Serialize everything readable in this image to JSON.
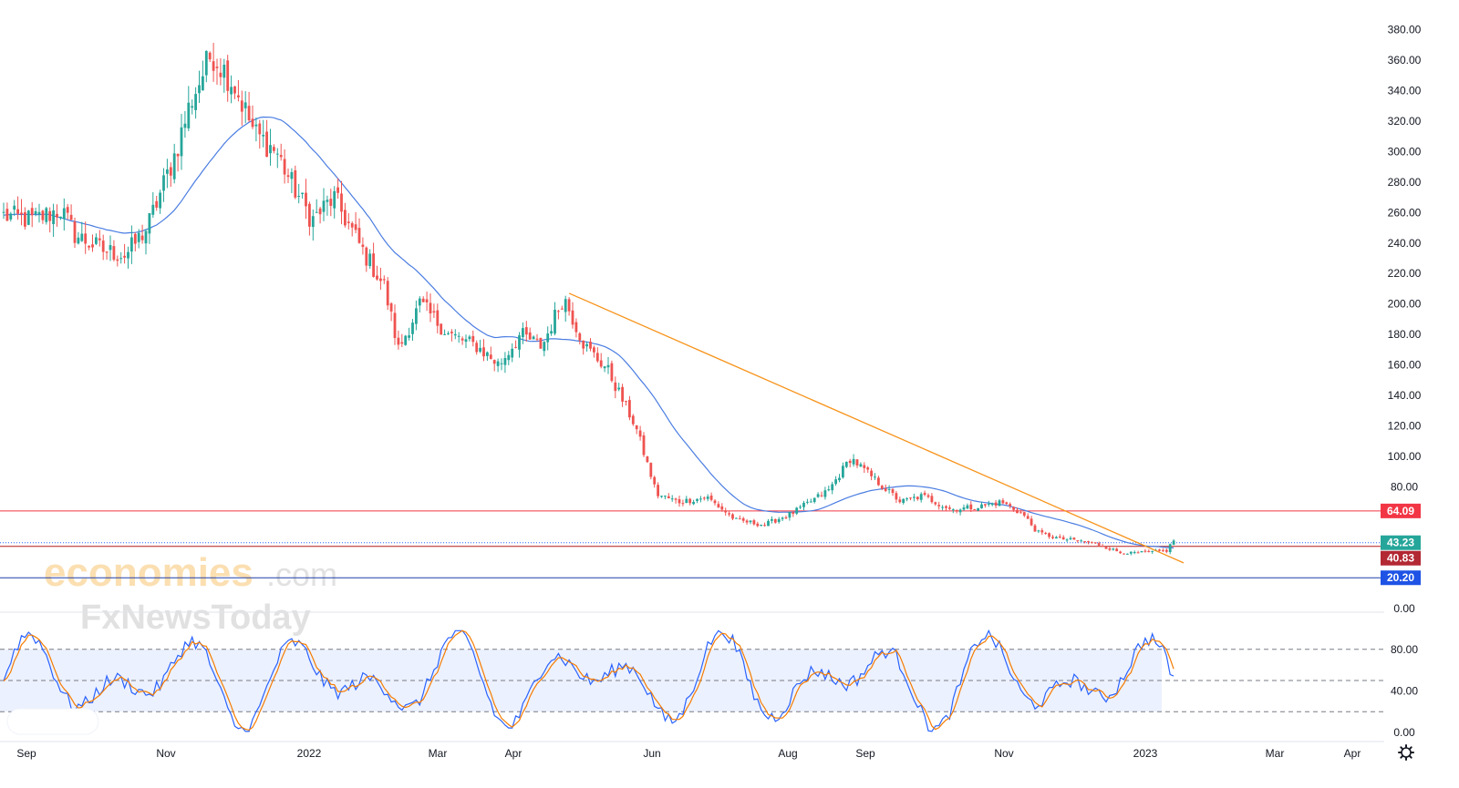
{
  "watermark": {
    "brand_main": "economies",
    "brand_suffix": ".com",
    "brand_sub": "FxNewsToday"
  },
  "chart_data": [
    {
      "type": "candlestick",
      "y_axis_ticks": [
        "380.00",
        "360.00",
        "340.00",
        "320.00",
        "300.00",
        "280.00",
        "260.00",
        "240.00",
        "220.00",
        "200.00",
        "180.00",
        "160.00",
        "140.00",
        "120.00",
        "100.00",
        "80.00",
        "0.00"
      ],
      "ylim": [
        0,
        390
      ],
      "x_axis_labels": [
        "Sep",
        "Nov",
        "2022",
        "Mar",
        "Apr",
        "Jun",
        "Aug",
        "Sep",
        "Nov",
        "2023",
        "Mar",
        "Apr"
      ],
      "grid": false,
      "price_levels": [
        {
          "label": "64.09",
          "value": 64.09,
          "color": "#f23645",
          "badge_color": "#f23645"
        },
        {
          "label": "43.23",
          "value": 43.23,
          "color": "#2962ff",
          "badge_color": "#26a69a",
          "dotted": true
        },
        {
          "label": "40.83",
          "value": 40.83,
          "color": "#b71c1c",
          "badge_color": "#b22833"
        },
        {
          "label": "20.20",
          "value": 20.2,
          "color": "#1e3fa8",
          "badge_color": "#1e53e5"
        }
      ],
      "trendline": {
        "from_value": 207,
        "to_value": 30,
        "color": "#f7931a"
      },
      "moving_average_color": "#4a7de2",
      "up_color": "#26a69a",
      "down_color": "#ef5350",
      "close_anchors": [
        [
          0,
          258
        ],
        [
          0.02,
          255
        ],
        [
          0.04,
          262
        ],
        [
          0.05,
          245
        ],
        [
          0.07,
          235
        ],
        [
          0.085,
          232
        ],
        [
          0.1,
          250
        ],
        [
          0.12,
          300
        ],
        [
          0.13,
          332
        ],
        [
          0.145,
          365
        ],
        [
          0.16,
          345
        ],
        [
          0.175,
          312
        ],
        [
          0.19,
          300
        ],
        [
          0.2,
          280
        ],
        [
          0.215,
          255
        ],
        [
          0.23,
          270
        ],
        [
          0.25,
          235
        ],
        [
          0.265,
          212
        ],
        [
          0.275,
          170
        ],
        [
          0.29,
          200
        ],
        [
          0.31,
          180
        ],
        [
          0.33,
          172
        ],
        [
          0.345,
          160
        ],
        [
          0.36,
          180
        ],
        [
          0.375,
          172
        ],
        [
          0.39,
          205
        ],
        [
          0.405,
          172
        ],
        [
          0.42,
          158
        ],
        [
          0.44,
          120
        ],
        [
          0.455,
          75
        ],
        [
          0.47,
          70
        ],
        [
          0.49,
          73
        ],
        [
          0.51,
          58
        ],
        [
          0.53,
          55
        ],
        [
          0.55,
          63
        ],
        [
          0.575,
          78
        ],
        [
          0.59,
          99
        ],
        [
          0.61,
          82
        ],
        [
          0.625,
          70
        ],
        [
          0.64,
          74
        ],
        [
          0.66,
          65
        ],
        [
          0.68,
          67
        ],
        [
          0.695,
          70
        ],
        [
          0.71,
          62
        ],
        [
          0.72,
          50
        ],
        [
          0.735,
          46
        ],
        [
          0.76,
          43
        ],
        [
          0.78,
          36
        ],
        [
          0.8,
          37
        ],
        [
          0.81,
          38
        ],
        [
          0.815,
          45
        ]
      ]
    },
    {
      "type": "line",
      "title": "",
      "y_axis_ticks": [
        "80.00",
        "40.00",
        "0.00"
      ],
      "ylim": [
        0,
        100
      ],
      "band": [
        20,
        80
      ],
      "midline": 50,
      "series_colors": [
        "#2962ff",
        "#f57c00"
      ]
    }
  ],
  "settings_icon": "gear-icon"
}
